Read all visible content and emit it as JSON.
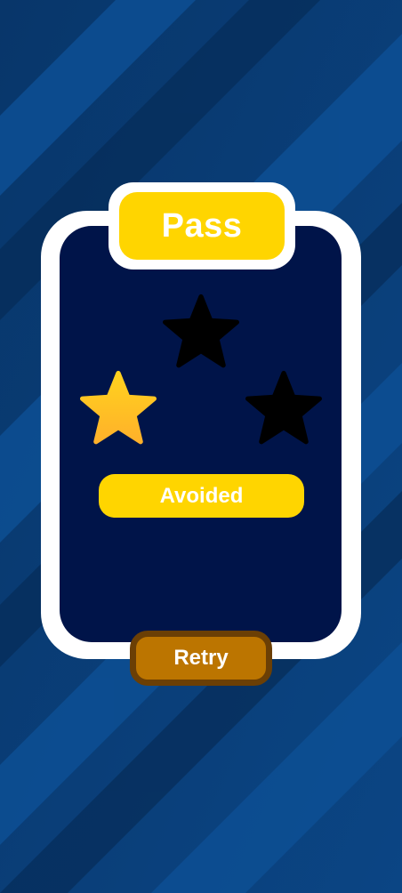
{
  "title": "Pass",
  "stars": {
    "earned": 1,
    "total": 3,
    "filled_color": "#ffc21a",
    "empty_color": "#000000"
  },
  "result_label": "Avoided",
  "retry_label": "Retry",
  "colors": {
    "background": "#0a3b70",
    "card_border": "#ffffff",
    "card_fill": "#001449",
    "accent_yellow": "#ffd500",
    "retry_fill": "#bc7500",
    "retry_border": "#6b3f05"
  }
}
